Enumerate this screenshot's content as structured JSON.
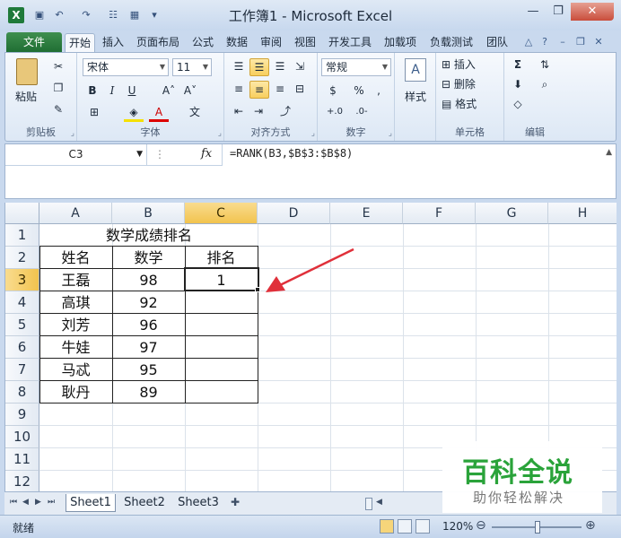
{
  "window": {
    "title": "工作簿1 - Microsoft Excel",
    "app_icon": "X"
  },
  "ribbon_tabs": [
    "文件",
    "开始",
    "插入",
    "页面布局",
    "公式",
    "数据",
    "审阅",
    "视图",
    "开发工具",
    "加载项",
    "负载测试",
    "团队"
  ],
  "ribbon": {
    "paste_label": "粘贴",
    "clipboard_label": "剪贴板",
    "font_name": "宋体",
    "font_size": "11",
    "font_label": "字体",
    "align_label": "对齐方式",
    "number_format": "常规",
    "number_label": "数字",
    "style_label": "样式",
    "insert_label": "插入",
    "delete_label": "删除",
    "format_label": "格式",
    "cells_label": "单元格",
    "editing_label": "编辑",
    "bold": "B",
    "italic": "I",
    "underline": "U",
    "sigma": "Σ",
    "percent": "%",
    "comma": ","
  },
  "formula_bar": {
    "name_box": "C3",
    "fx": "fx",
    "formula": "=RANK(B3,$B$3:$B$8)"
  },
  "grid": {
    "columns": [
      "A",
      "B",
      "C",
      "D",
      "E",
      "F",
      "G",
      "H"
    ],
    "rows": [
      "1",
      "2",
      "3",
      "4",
      "5",
      "6",
      "7",
      "8",
      "9",
      "10",
      "11",
      "12"
    ],
    "selected_cell": "C3",
    "title": "数学成绩排名",
    "headers": [
      "姓名",
      "数学",
      "排名"
    ],
    "data": [
      [
        "王磊",
        "98",
        "1"
      ],
      [
        "高琪",
        "92",
        ""
      ],
      [
        "刘芳",
        "96",
        ""
      ],
      [
        "牛娃",
        "97",
        ""
      ],
      [
        "马忒",
        "95",
        ""
      ],
      [
        "耿丹",
        "89",
        ""
      ]
    ]
  },
  "sheets": [
    "Sheet1",
    "Sheet2",
    "Sheet3"
  ],
  "status": {
    "ready": "就绪",
    "zoom": "120%"
  },
  "watermark": {
    "line1": "百科全说",
    "line2": "助你轻松解决"
  },
  "colors": {
    "accent_file_tab": "#1f6e33",
    "selection": "#f2c34e",
    "arrow": "#e0303a",
    "watermark_green": "#2aa33a"
  }
}
